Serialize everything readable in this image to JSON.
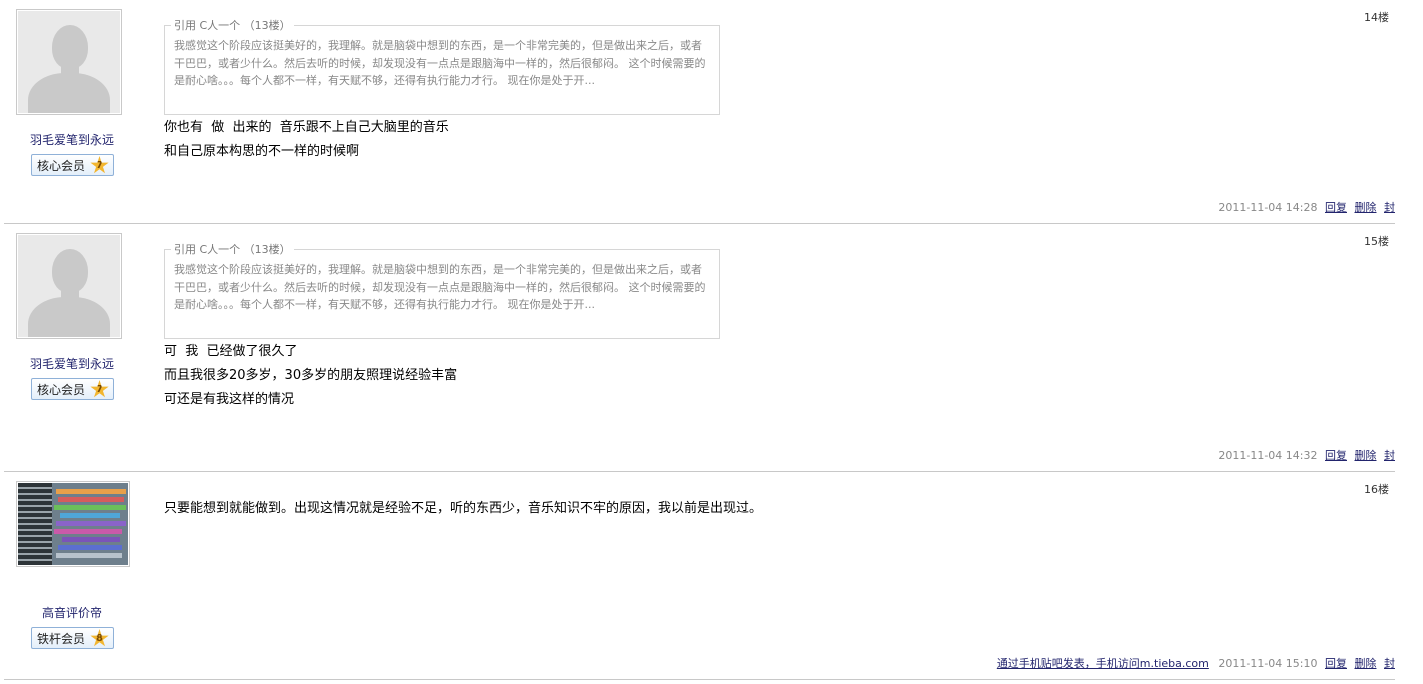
{
  "posts": [
    {
      "floor": "14楼",
      "username": "羽毛爱笔到永远",
      "badge": "核心会员",
      "level": "7",
      "quote_title": "引用 C人一个 （13楼）",
      "quote_text": "我感觉这个阶段应该挺美好的，我理解。就是脑袋中想到的东西，是一个非常完美的，但是做出来之后，或者干巴巴，或者少什么。然后去听的时候，却发现没有一点点是跟脑海中一样的，然后很郁闷。 这个时候需要的是耐心啥。。。每个人都不一样，有天赋不够，还得有执行能力才行。 现在你是处于开...",
      "lines": [
        "你也有  做  出来的  音乐跟不上自己大脑里的音乐",
        "和自己原本构思的不一样的时候啊"
      ],
      "time": "2011-11-04 14:28",
      "reply": "回复",
      "delete": "删除",
      "ban": "封"
    },
    {
      "floor": "15楼",
      "username": "羽毛爱笔到永远",
      "badge": "核心会员",
      "level": "7",
      "quote_title": "引用 C人一个 （13楼）",
      "quote_text": "我感觉这个阶段应该挺美好的，我理解。就是脑袋中想到的东西，是一个非常完美的，但是做出来之后，或者干巴巴，或者少什么。然后去听的时候，却发现没有一点点是跟脑海中一样的，然后很郁闷。 这个时候需要的是耐心啥。。。每个人都不一样，有天赋不够，还得有执行能力才行。 现在你是处于开...",
      "lines": [
        "可  我  已经做了很久了",
        "而且我很多20多岁，30多岁的朋友照理说经验丰富",
        "可还是有我这样的情况"
      ],
      "time": "2011-11-04 14:32",
      "reply": "回复",
      "delete": "删除",
      "ban": "封"
    },
    {
      "floor": "16楼",
      "username": "高音评价帝",
      "badge": "铁杆会员",
      "level": "8",
      "lines": [
        "只要能想到就能做到。出现这情况就是经验不足，听的东西少，音乐知识不牢的原因，我以前是出现过。"
      ],
      "source": "通过手机贴吧发表，手机访问m.tieba.com",
      "time": "2011-11-04 15:10",
      "reply": "回复",
      "delete": "删除",
      "ban": "封"
    }
  ]
}
